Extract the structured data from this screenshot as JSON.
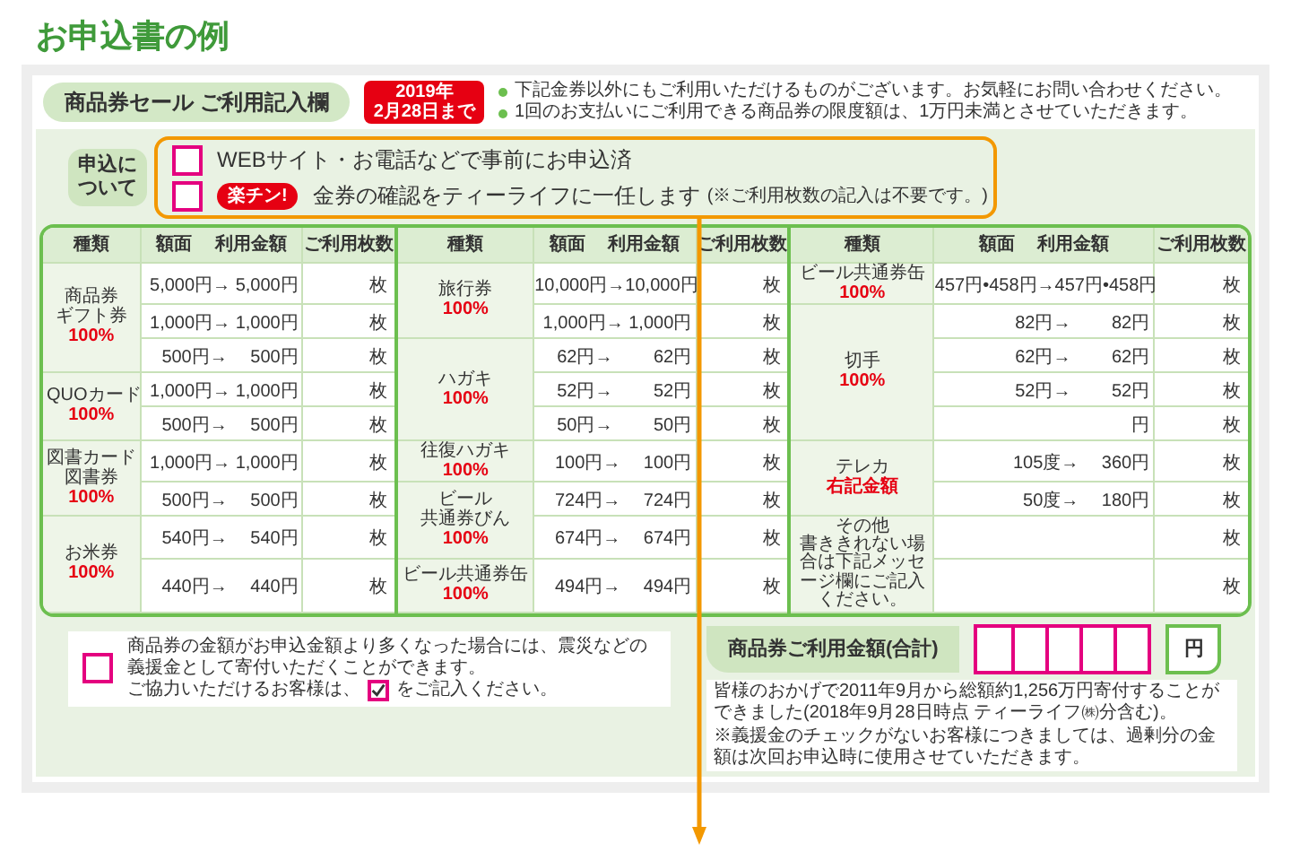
{
  "title": "お申込書の例",
  "section": {
    "title": "商品券セール ご利用記入欄",
    "deadline": "2019年\n2月28日まで"
  },
  "notices": [
    "下記金券以外にもご利用いただけるものがございます。お気軽にお問い合わせください。",
    "1回のお支払いにご利用できる商品券の限度額は、1万円未満とさせていただきます。"
  ],
  "application": {
    "label": "申込について",
    "options": [
      {
        "checked": false,
        "text": "WEBサイト・お電話などで事前にお申込済"
      },
      {
        "checked": false,
        "badge": "楽チン!",
        "text": "金券の確認をティーライフに一任します",
        "note": "(※ご利用枚数の記入は不要です。)"
      }
    ]
  },
  "groups": [
    {
      "columns": [
        "種類",
        "額面　 利用金額",
        "ご利用枚数"
      ],
      "types": [
        {
          "name": [
            "商品券",
            "ギフト券"
          ],
          "rate": "100%",
          "rows": [
            {
              "amount": "5,000円→ 5,000円",
              "count": "枚"
            },
            {
              "amount": "1,000円→ 1,000円",
              "count": "枚"
            },
            {
              "amount": "500円→　 500円",
              "count": "枚"
            }
          ]
        },
        {
          "name": [
            "QUOカード"
          ],
          "rate": "100%",
          "rows": [
            {
              "amount": "1,000円→ 1,000円",
              "count": "枚"
            },
            {
              "amount": "500円→　 500円",
              "count": "枚"
            }
          ]
        },
        {
          "name": [
            "図書カード",
            "図書券"
          ],
          "rate": "100%",
          "rows": [
            {
              "amount": "1,000円→ 1,000円",
              "count": "枚"
            },
            {
              "amount": "500円→　 500円",
              "count": "枚"
            }
          ]
        },
        {
          "name": [
            "お米券"
          ],
          "rate": "100%",
          "rows": [
            {
              "amount": "540円→　 540円",
              "count": "枚"
            },
            {
              "amount": "440円→　 440円",
              "count": "枚"
            }
          ]
        }
      ]
    },
    {
      "columns": [
        "種類",
        "額面　 利用金額",
        "ご利用枚数"
      ],
      "types": [
        {
          "name": [
            "旅行券"
          ],
          "rate": "100%",
          "rows": [
            {
              "amount": "10,000円→10,000円",
              "count": "枚"
            },
            {
              "amount": "1,000円→ 1,000円",
              "count": "枚"
            }
          ]
        },
        {
          "name": [
            "ハガキ"
          ],
          "rate": "100%",
          "rows": [
            {
              "amount": "62円→　　 62円",
              "count": "枚"
            },
            {
              "amount": "52円→　　 52円",
              "count": "枚"
            },
            {
              "amount": "50円→　　 50円",
              "count": "枚"
            }
          ]
        },
        {
          "name": [
            "往復ハガキ"
          ],
          "rate": "100%",
          "rows": [
            {
              "amount": "100円→　 100円",
              "count": "枚"
            }
          ]
        },
        {
          "name": [
            "ビール",
            "共通券びん"
          ],
          "rate": "100%",
          "rows": [
            {
              "amount": "724円→　 724円",
              "count": "枚"
            },
            {
              "amount": "674円→　 674円",
              "count": "枚"
            }
          ]
        },
        {
          "name": [
            "ビール共通券缶"
          ],
          "rate": "100%",
          "rows": [
            {
              "amount": "494円→　 494円",
              "count": "枚"
            }
          ]
        }
      ]
    },
    {
      "columns": [
        "種類",
        "額面　 利用金額",
        "ご利用枚数"
      ],
      "types": [
        {
          "name": [
            "ビール共通券缶"
          ],
          "rate": "100%",
          "rows": [
            {
              "amount": "457円•458円→457円•458円",
              "count": "枚"
            }
          ]
        },
        {
          "name": [
            "切手"
          ],
          "rate": "100%",
          "rows": [
            {
              "amount": "82円→　　 82円",
              "count": "枚"
            },
            {
              "amount": "62円→　　 62円",
              "count": "枚"
            },
            {
              "amount": "52円→　　 52円",
              "count": "枚"
            },
            {
              "amount": "円",
              "count": "枚"
            }
          ]
        },
        {
          "name": [
            "テレカ"
          ],
          "rate": "右記金額",
          "rows": [
            {
              "amount": "105度→　 360円",
              "count": "枚"
            },
            {
              "amount": "50度→　 180円",
              "count": "枚"
            }
          ]
        },
        {
          "name": [
            "その他"
          ],
          "note": "書ききれない場合は下記メッセージ欄にご記入ください。",
          "rows": [
            {
              "count": "枚"
            },
            {
              "count": "枚"
            }
          ]
        }
      ]
    }
  ],
  "donation": {
    "checked": false,
    "text": "商品券の金額がお申込金額より多くなった場合には、震災などの義援金として寄付いただくことができます。",
    "prompt_before": "ご協力いただけるお客様は、",
    "prompt_after": "をご記入ください。"
  },
  "total": {
    "label": "商品券ご利用金額(合計)",
    "unit": "円"
  },
  "notes": [
    "皆様のおかげで2011年9月から総額約1,256万円寄付することができました(2018年9月28日時点 ティーライフ㈱分含む)。",
    "※義援金のチェックがないお客様につきましては、過剰分の金額は次回お申込時に使用させていただきます。"
  ]
}
